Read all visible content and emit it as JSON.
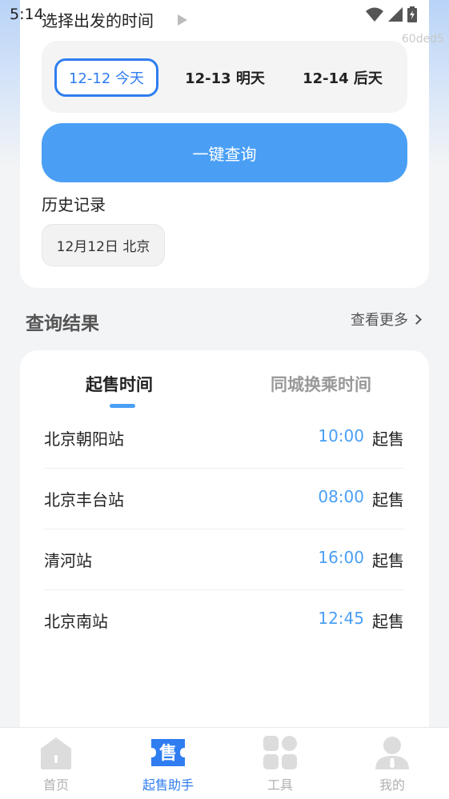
{
  "status_bar": {
    "time": "5:14"
  },
  "watermark": "60ded5",
  "departure": {
    "title": "选择出发的时间",
    "dates": [
      {
        "label": "12-12 今天",
        "selected": true
      },
      {
        "label": "12-13 明天",
        "selected": false
      },
      {
        "label": "12-14 后天",
        "selected": false
      }
    ],
    "query_button": "一键查询"
  },
  "history": {
    "title": "历史记录",
    "items": [
      "12月12日 北京"
    ]
  },
  "results": {
    "title": "查询结果",
    "more": "查看更多",
    "tabs": [
      {
        "label": "起售时间",
        "active": true
      },
      {
        "label": "同城换乘时间",
        "active": false
      }
    ],
    "rows": [
      {
        "station": "北京朝阳站",
        "time": "10:00",
        "label": "起售"
      },
      {
        "station": "北京丰台站",
        "time": "08:00",
        "label": "起售"
      },
      {
        "station": "清河站",
        "time": "16:00",
        "label": "起售"
      },
      {
        "station": "北京南站",
        "time": "12:45",
        "label": "起售"
      }
    ]
  },
  "nav": [
    {
      "label": "首页",
      "icon": "home-icon",
      "active": false
    },
    {
      "label": "起售助手",
      "icon": "ticket-icon",
      "active": true
    },
    {
      "label": "工具",
      "icon": "grid-icon",
      "active": false
    },
    {
      "label": "我的",
      "icon": "user-icon",
      "active": false
    }
  ],
  "colors": {
    "accent": "#4a9ff5",
    "selected": "#2f7df0",
    "inactive": "#b0b0b0"
  }
}
